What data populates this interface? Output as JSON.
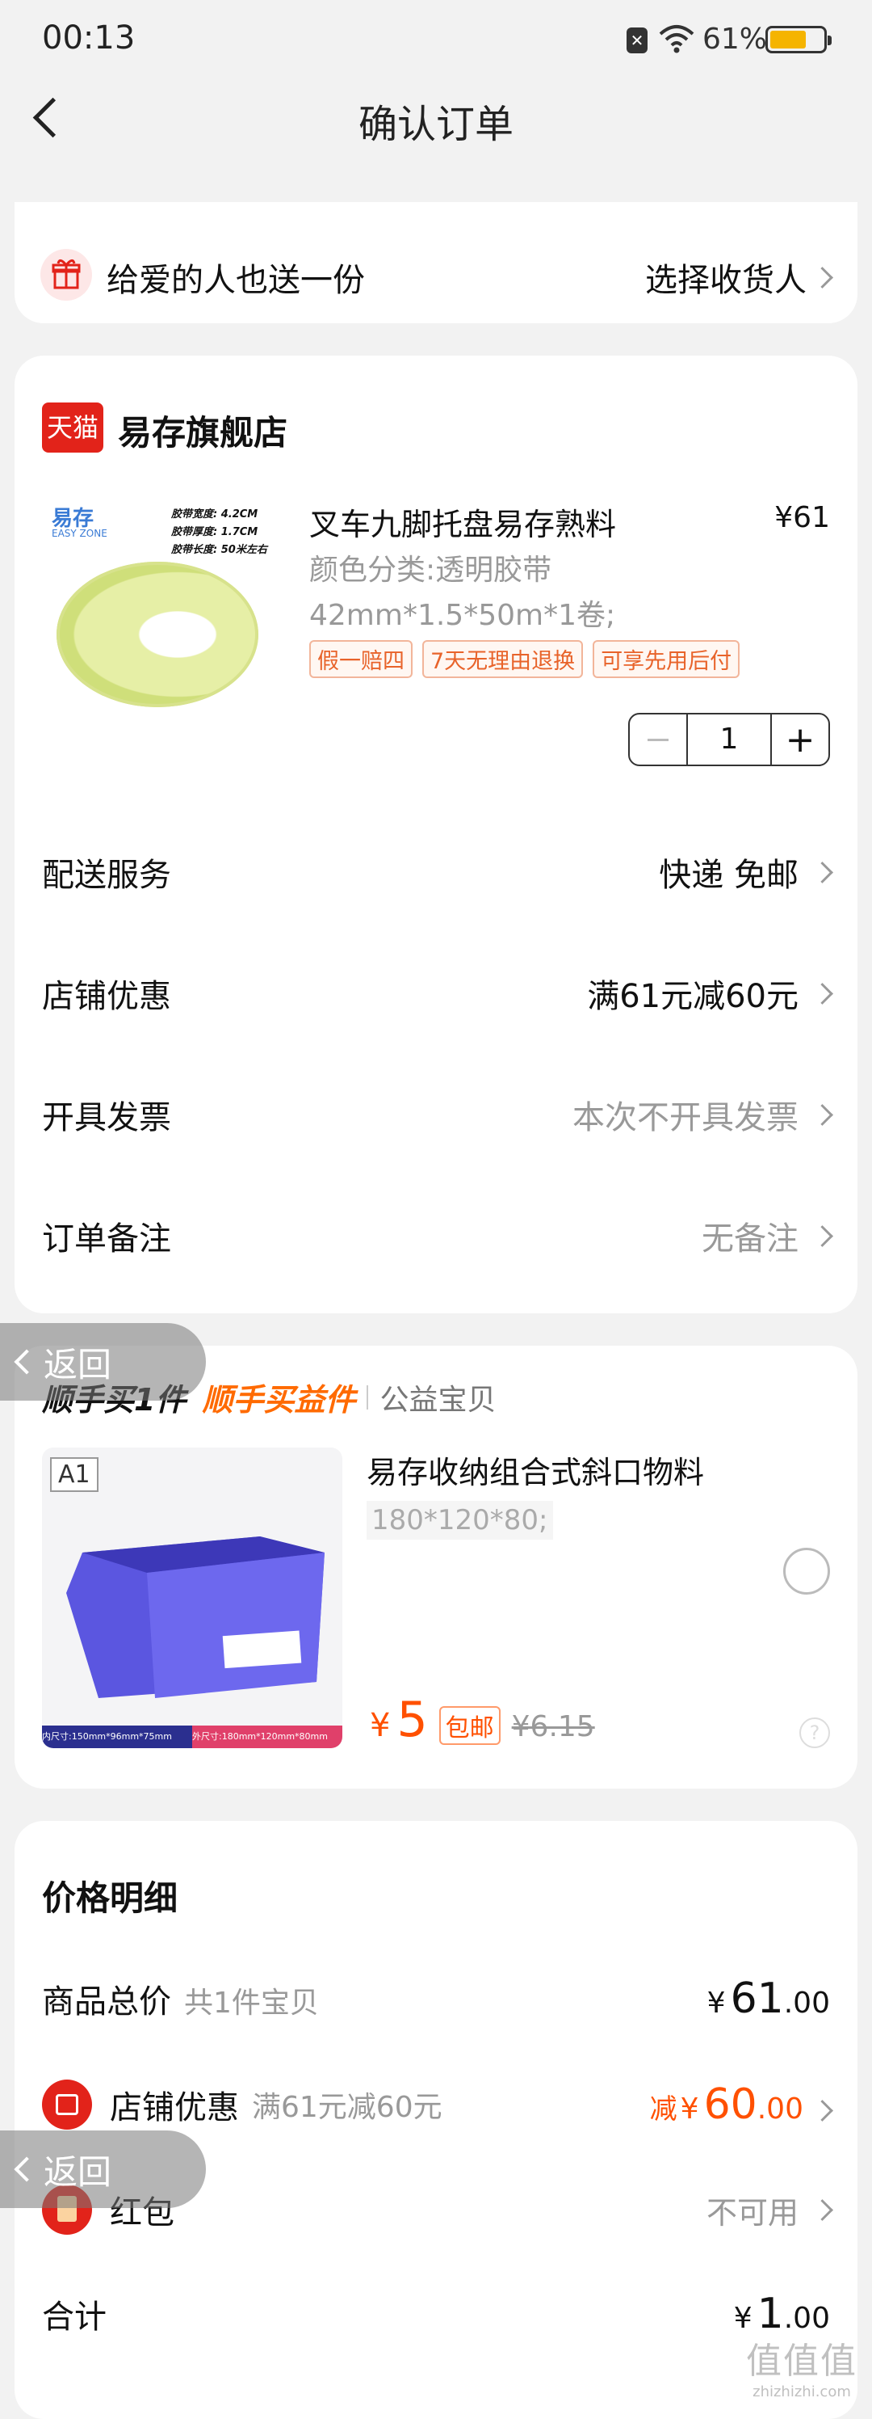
{
  "status_bar": {
    "time": "00:13",
    "battery": "61%"
  },
  "header": {
    "title": "确认订单"
  },
  "gift": {
    "label": "给爱的人也送一份",
    "action": "选择收货人"
  },
  "store": {
    "badge": "天猫",
    "name": "易存旗舰店",
    "item": {
      "title": "叉车九脚托盘易存熟料",
      "price": "¥61",
      "variant_line1": "颜色分类:透明胶带",
      "variant_line2": "42mm*1.5*50m*1卷;",
      "tags": [
        "假一赔四",
        "7天无理由退换",
        "可享先用后付"
      ],
      "quantity": "1",
      "image_brand": "易存",
      "image_brand_en": "EASY ZONE",
      "image_spec1": "胶带宽度: 4.2CM",
      "image_spec2": "胶带厚度: 1.7CM",
      "image_spec3": "胶带长度: 50米左右"
    },
    "rows": [
      {
        "label": "配送服务",
        "value": "快递 免邮"
      },
      {
        "label": "店铺优惠",
        "value": "满61元减60元"
      },
      {
        "label": "开具发票",
        "value": "本次不开具发票"
      },
      {
        "label": "订单备注",
        "value": "无备注"
      }
    ]
  },
  "addon": {
    "title1": "顺手买1件",
    "title2": "顺手买益件",
    "title3": "公益宝贝",
    "image_label": "A1",
    "image_left_caption": "内尺寸:150mm*96mm*75mm",
    "image_right_caption": "外尺寸:180mm*120mm*80mm",
    "name": "易存收纳组合式斜口物料",
    "spec": "180*120*80;",
    "price_symbol": "¥",
    "price": "5",
    "free_ship": "包邮",
    "orig_price": "¥6.15"
  },
  "price_detail": {
    "title": "价格明细",
    "total_label": "商品总价",
    "total_sub": "共1件宝贝",
    "total_symbol": "¥",
    "total_int": "61",
    "total_dec": ".00",
    "shop_label": "店铺优惠",
    "shop_sub": "满61元减60元",
    "shop_prefix": "减",
    "shop_symbol": "¥",
    "shop_int": "60",
    "shop_dec": ".00",
    "redpacket_label": "红包",
    "redpacket_value": "不可用",
    "sum_label": "合计",
    "sum_symbol": "¥",
    "sum_int": "1",
    "sum_dec": ".00"
  },
  "overlay": {
    "back_label": "返回"
  },
  "watermark": {
    "text": "值值值",
    "sub": "zhizhizhi.com"
  },
  "colors": {
    "accent": "#ff5000",
    "tmall": "#e2231a",
    "addon_orange": "#ff6a00"
  }
}
